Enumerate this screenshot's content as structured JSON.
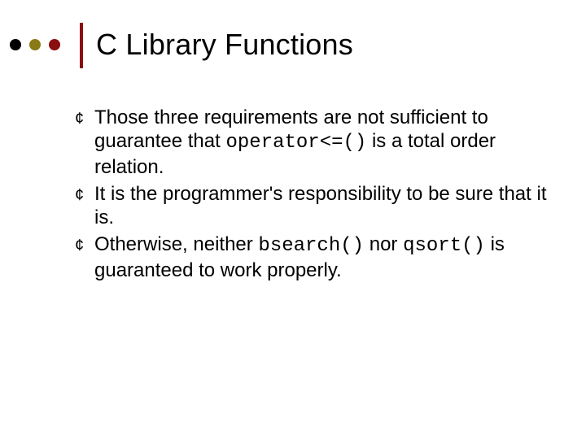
{
  "colors": {
    "dot_black": "#000000",
    "dot_olive": "#8a7a17",
    "dot_red": "#8a0f0f",
    "accent": "#8a0f0f"
  },
  "title": "C Library Functions",
  "bullets": [
    {
      "pre": "Those three requirements are not sufficient to guarantee that ",
      "code": "operator<=()",
      "post": " is a total order relation."
    },
    {
      "pre": "It is the programmer's responsibility to be sure that it is.",
      "code": "",
      "post": ""
    },
    {
      "pre": "Otherwise, neither ",
      "code": "bsearch()",
      "mid": " nor ",
      "code2": "qsort()",
      "post": " is guaranteed to work properly."
    }
  ],
  "bullet_marker": "¢"
}
